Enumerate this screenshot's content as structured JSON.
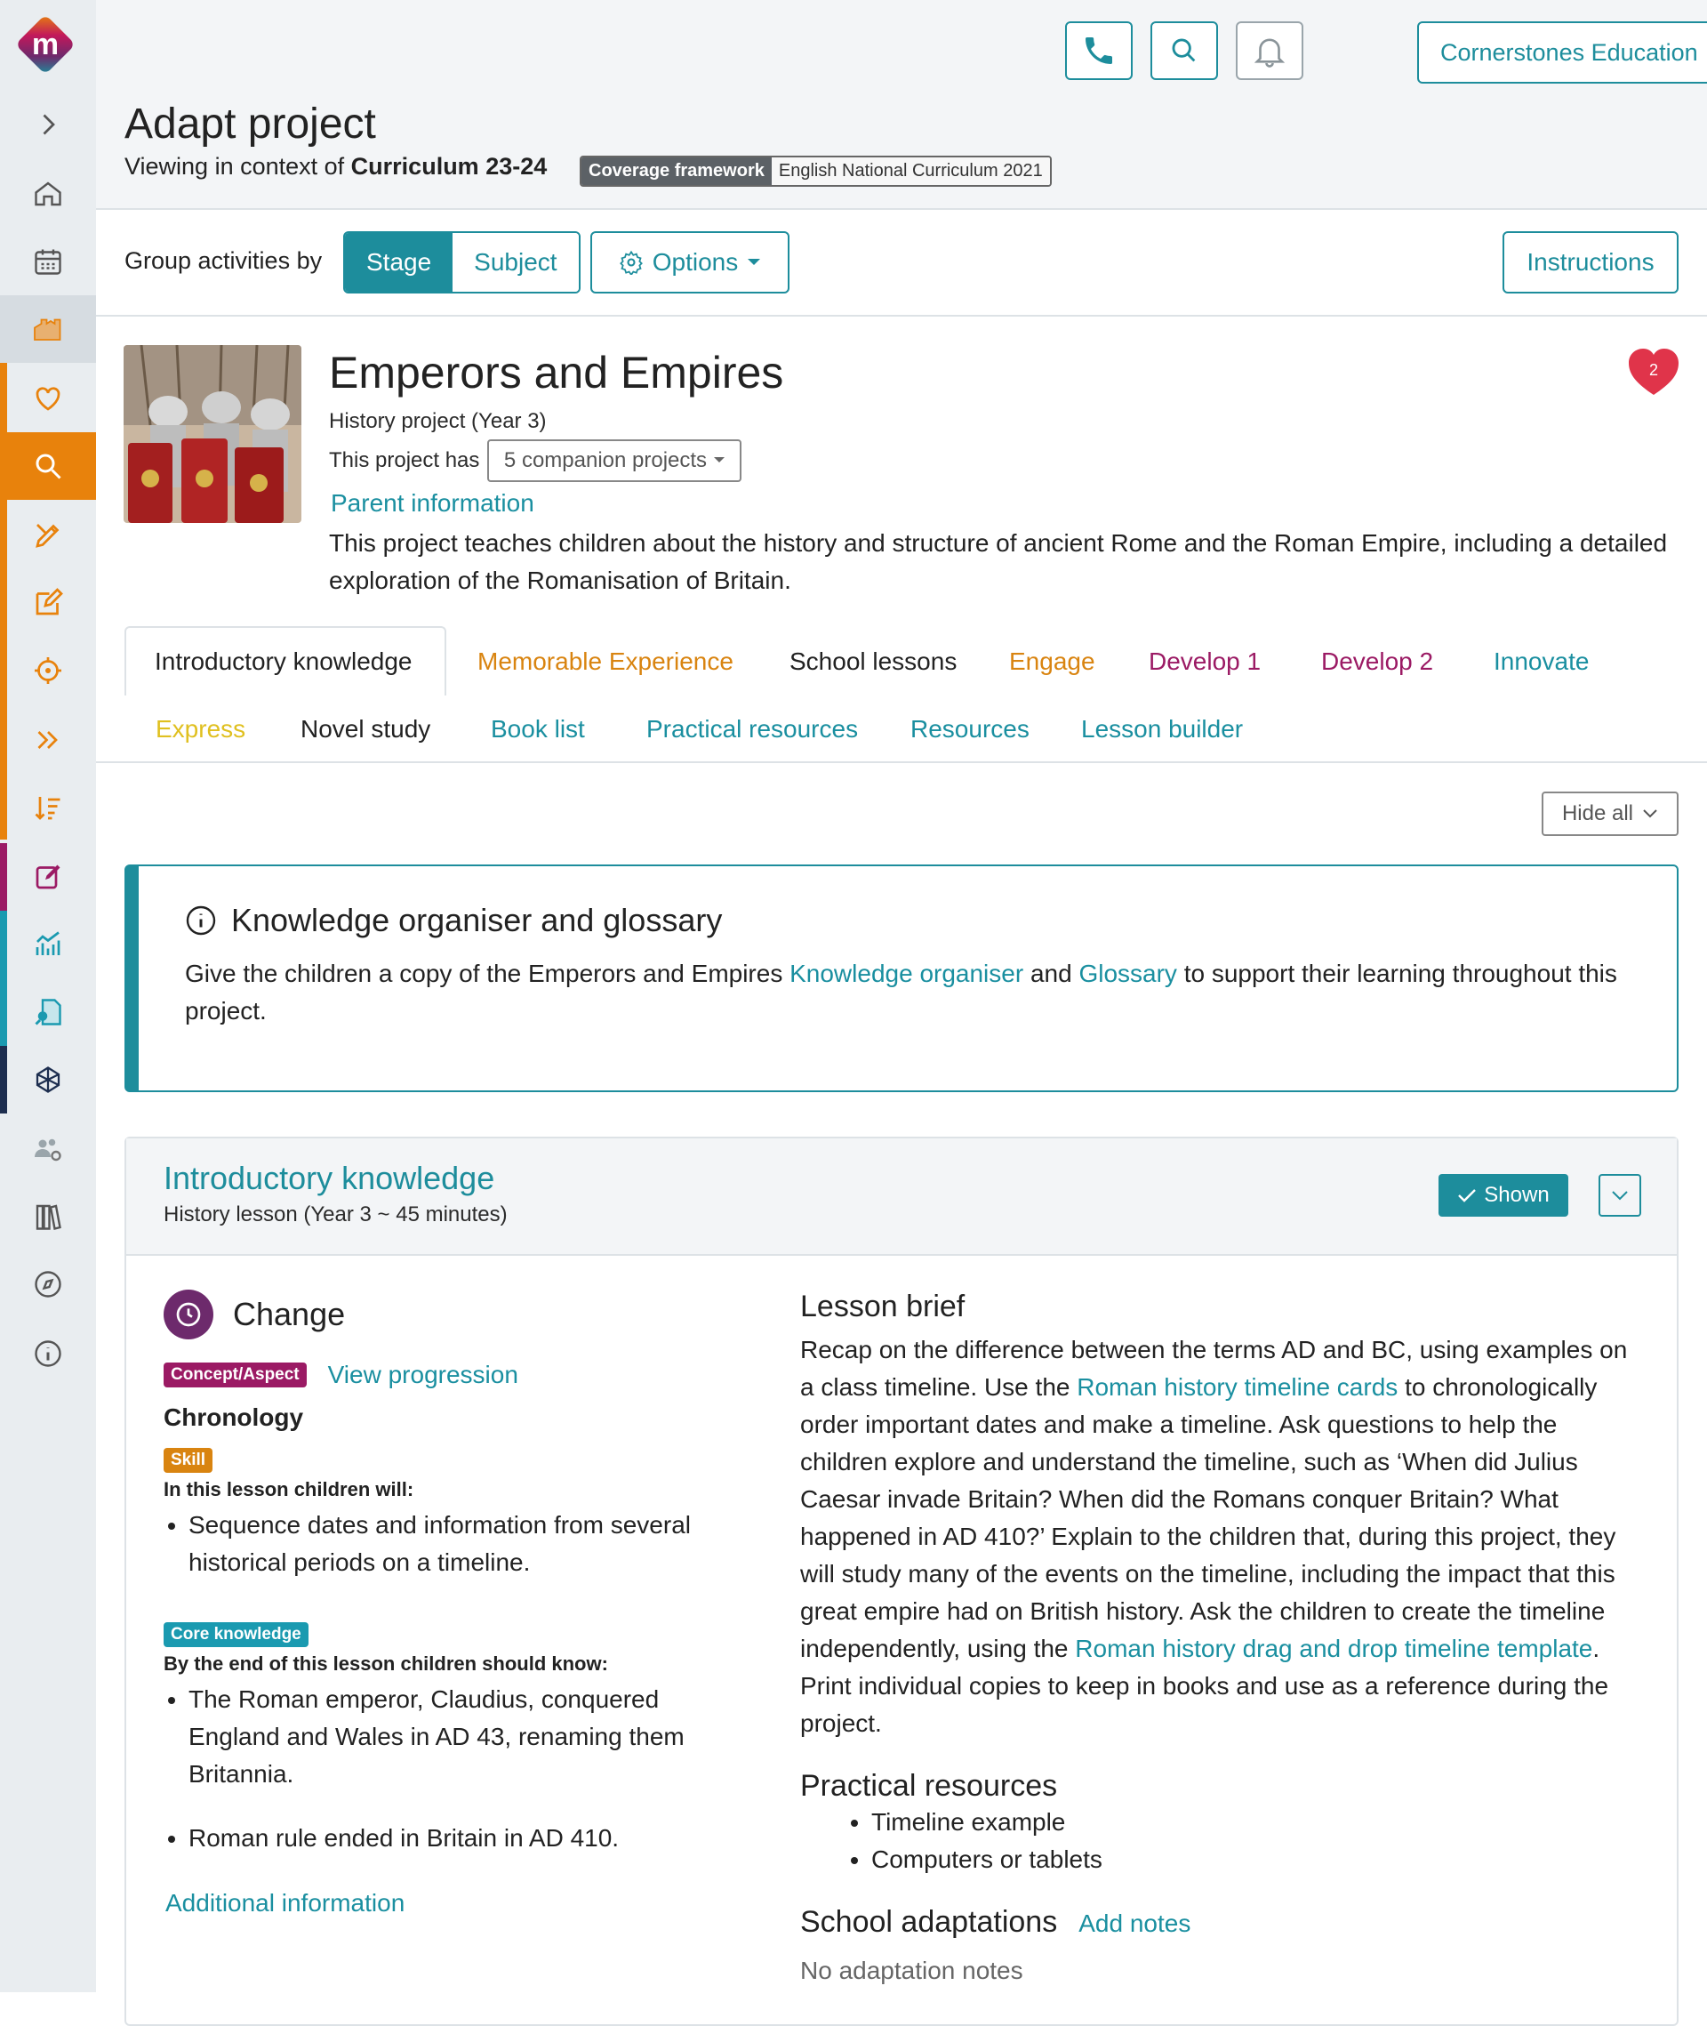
{
  "header": {
    "org_name": "Cornerstones Education",
    "page_title": "Adapt project",
    "context_prefix": "Viewing in context of",
    "context_value": "Curriculum 23-24",
    "framework_key": "Coverage framework",
    "framework_value": "English National Curriculum 2021"
  },
  "groupbar": {
    "label": "Group activities by",
    "stage": "Stage",
    "subject": "Subject",
    "options": "Options",
    "instructions": "Instructions"
  },
  "project": {
    "title": "Emperors and Empires",
    "subtitle": "History project (Year 3)",
    "has_label": "This project has",
    "companion": "5 companion projects",
    "parent_info": "Parent information",
    "description": "This project teaches children about the history and structure of ancient Rome and the Roman Empire, including a detailed exploration of the Romanisation of Britain.",
    "favourites": "2"
  },
  "tabs": [
    {
      "label": "Introductory knowledge",
      "color": "#222222"
    },
    {
      "label": "Memorable Experience",
      "color": "#d98410"
    },
    {
      "label": "School lessons",
      "color": "#222222"
    },
    {
      "label": "Engage",
      "color": "#d98410"
    },
    {
      "label": "Develop 1",
      "color": "#9b1a64"
    },
    {
      "label": "Develop 2",
      "color": "#9b1a64"
    },
    {
      "label": "Innovate",
      "color": "#1a8fa0"
    },
    {
      "label": "Express",
      "color": "#e0c020"
    },
    {
      "label": "Novel study",
      "color": "#222222"
    },
    {
      "label": "Book list",
      "color": "#1a8fa0"
    },
    {
      "label": "Practical resources",
      "color": "#1a8fa0"
    },
    {
      "label": "Resources",
      "color": "#1a8fa0"
    },
    {
      "label": "Lesson builder",
      "color": "#1a8fa0"
    }
  ],
  "hide_all": "Hide all",
  "info_card": {
    "title": "Knowledge organiser and glossary",
    "text_1": "Give the children a copy of the Emperors and Empires",
    "link_1": "Knowledge organiser",
    "text_2": "and",
    "link_2": "Glossary",
    "text_3": "to support their learning throughout this project."
  },
  "lesson": {
    "title": "Introductory knowledge",
    "subtitle": "History lesson (Year 3 ~ 45 minutes)",
    "shown": "Shown",
    "concept_name": "Change",
    "concept_pill": "Concept/Aspect",
    "view_progression": "View progression",
    "concept_value": "Chronology",
    "skill_pill": "Skill",
    "skill_intro": "In this lesson children will:",
    "skills": [
      "Sequence dates and information from several historical periods on a timeline."
    ],
    "core_pill": "Core knowledge",
    "core_intro": "By the end of this lesson children should know:",
    "core": [
      "The Roman emperor, Claudius, conquered England and Wales in AD 43, renaming them Britannia.",
      "Roman rule ended in Britain in AD 410."
    ],
    "additional": "Additional information",
    "brief_title": "Lesson brief",
    "brief_1": "Recap on the difference between the terms AD and BC, using examples on a class timeline. Use the",
    "brief_link_1": "Roman history timeline cards",
    "brief_2": "to chronologically order important dates and make a timeline. Ask questions to help the children explore and understand the timeline, such as ‘When did Julius Caesar invade Britain? When did the Romans conquer Britain? What happened in AD 410?’ Explain to the children that, during this project, they will study many of the events on the timeline, including the impact that this great empire had on British history. Ask the children to create the timeline independently, using the",
    "brief_link_2": "Roman history drag and drop timeline template",
    "brief_3": ". Print individual copies to keep in books and use as a reference during the project.",
    "practical_title": "Practical resources",
    "practical": [
      "Timeline example",
      "Computers or tablets"
    ],
    "adapt_title": "School adaptations",
    "add_notes": "Add notes",
    "no_notes": "No adaptation notes"
  },
  "colors": {
    "teal": "#1d8d9c",
    "orange": "#e8820c",
    "purple": "#9b1a64",
    "navy": "#1d2e4f"
  }
}
